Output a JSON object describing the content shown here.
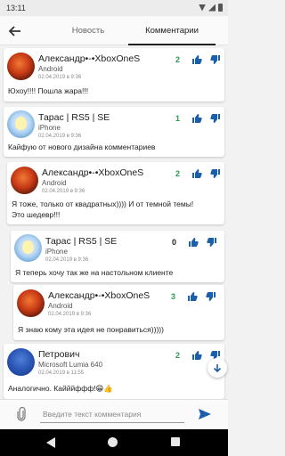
{
  "statusbar": {
    "time": "13:11"
  },
  "tabs": [
    {
      "label": "Новость"
    },
    {
      "label": "Комментарии"
    }
  ],
  "comments": [
    {
      "author": "Александр•-•XboxOneS",
      "device": "Android",
      "date": "02.04.2019 в 9:36",
      "score": "2",
      "text": [
        "Юхоу!!!! Пошла жара!!!"
      ]
    },
    {
      "author": "Тарас | RS5 | SE",
      "device": "iPhone",
      "date": "02.04.2019 в 9:36",
      "score": "1",
      "text": [
        "Кайфую от нового дизайна комментариев"
      ]
    },
    {
      "author": "Александр•-•XboxOneS",
      "device": "Android",
      "date": "02.04.2019 в 9:36",
      "score": "2",
      "text": [
        "Я тоже, только от квадратных)))) И от темной темы!",
        "Это шедевр!!!"
      ]
    },
    {
      "author": "Тарас | RS5 | SE",
      "device": "iPhone",
      "date": "02.04.2019 в 9:36",
      "score": "0",
      "text": [
        "Я теперь хочу так же на настольном клиенте"
      ]
    },
    {
      "author": "Александр•-•XboxOneS",
      "device": "Android",
      "date": "02.04.2019 в 9:36",
      "score": "3",
      "text": [
        "Я знаю кому эта идея не понравиться)))))"
      ]
    },
    {
      "author": "Петрович",
      "device": "Microsoft Lumia 640",
      "date": "02.04.2019 в 11:55",
      "score": "2",
      "text": [
        "Аналогично. Кайййффф!😁👍"
      ]
    }
  ],
  "input": {
    "placeholder": "Введите текст комментария"
  },
  "colors": {
    "score_green": "#2e9b4e",
    "accent_blue": "#1b5faa"
  }
}
